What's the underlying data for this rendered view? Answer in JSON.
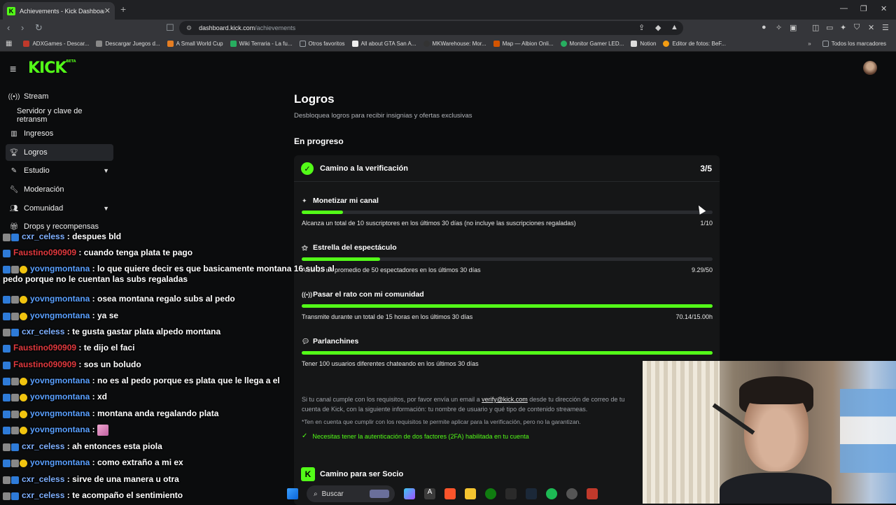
{
  "browser": {
    "tab_title": "Achievements - Kick Dashboard",
    "tab_close": "✕",
    "new_tab": "+",
    "url_host": "dashboard.kick.com",
    "url_path": "/achievements",
    "bookmarks": [
      {
        "label": "ADXGames - Descar...",
        "color": "#c0392b"
      },
      {
        "label": "Descargar Juegos d...",
        "color": "#888888"
      },
      {
        "label": "A Small World Cup",
        "color": "#e67e22"
      },
      {
        "label": "Wiki Terraria - La fu...",
        "color": "#27ae60"
      },
      {
        "label": "Otros favoritos",
        "color": "#9aa0a6"
      },
      {
        "label": "All about GTA San A...",
        "color": "#eeeeee"
      },
      {
        "label": "MKWarehouse: Mor...",
        "color": "#333333"
      },
      {
        "label": "Map — Albion Onli...",
        "color": "#d35400"
      },
      {
        "label": "Monitor Gamer LED...",
        "color": "#27ae60"
      },
      {
        "label": "Notion",
        "color": "#dddddd"
      },
      {
        "label": "Editor de fotos: BeF...",
        "color": "#f39c12"
      }
    ],
    "bookmarks_all": "Todos los marcadores"
  },
  "sidebar": {
    "items": [
      {
        "label": "Stream",
        "icon": "broadcast-icon"
      },
      {
        "label": "Servidor y clave de retransm",
        "icon": ""
      },
      {
        "label": "Ingresos",
        "icon": "chart-icon"
      },
      {
        "label": "Logros",
        "icon": "trophy-icon"
      },
      {
        "label": "Estudio",
        "icon": "pen-icon"
      },
      {
        "label": "Moderación",
        "icon": "wrench-icon"
      },
      {
        "label": "Comunidad",
        "icon": "people-icon"
      },
      {
        "label": "Drops y recompensas",
        "icon": "gift-icon"
      }
    ]
  },
  "main": {
    "title": "Logros",
    "subtitle": "Desbloquea logros para recibir insignias y ofertas exclusivas",
    "section": "En progreso",
    "card": {
      "title": "Camino a la verificación",
      "count": "3/5",
      "achievements": [
        {
          "title": "Monetizar mi canal",
          "desc": "Alcanza un total de 10 suscriptores en los últimos 30 días (no incluye las suscripciones regaladas)",
          "value": "1/10",
          "progress": 0.1
        },
        {
          "title": "Estrella del espectáculo",
          "desc": "Alcanza un promedio de 50 espectadores en los últimos 30 días",
          "value": "9.29/50",
          "progress": 0.19
        },
        {
          "title": "Pasar el rato con mi comunidad",
          "desc": "Transmite durante un total de 15 horas en los últimos 30 días",
          "value": "70.14/15.00h",
          "progress": 1.0
        },
        {
          "title": "Parlanchines",
          "desc": "Tener 100 usuarios diferentes chateando en los últimos 30 días",
          "value": "",
          "progress": 1.0
        }
      ],
      "note_prefix": "Si tu canal cumple con los requisitos, por favor envía un email a ",
      "note_email": "verify@kick.com",
      "note_suffix": " desde tu dirección de correo de tu cuenta de Kick, con la siguiente información: tu nombre de usuario y qué tipo de contenido streameas.",
      "note2": "*Ten en cuenta que cumplir con los requisitos te permite aplicar para la verificación, pero no la garantizan.",
      "note3": "Necesitas tener la autenticación de dos factores (2FA) habilitada en tu cuenta"
    },
    "card2_title": "Camino para ser Socio"
  },
  "chat": [
    {
      "user": "cxr_celess",
      "color": "#7fb0ff",
      "text": ": despues bld"
    },
    {
      "user": "Faustino090909",
      "color": "#e0393e",
      "text": ": cuando tenga plata te pago"
    },
    {
      "user": "yovngmontana",
      "color": "#5aa0ff",
      "text": ": lo que quiere decir es que basicamente montana 16 subs al pedo porque no le cuentan las subs regaladas"
    },
    {
      "user": "yovngmontana",
      "color": "#5aa0ff",
      "text": ": osea montana regalo subs al pedo"
    },
    {
      "user": "yovngmontana",
      "color": "#5aa0ff",
      "text": ": ya se"
    },
    {
      "user": "cxr_celess",
      "color": "#7fb0ff",
      "text": ": te gusta gastar plata alpedo montana"
    },
    {
      "user": "Faustino090909",
      "color": "#e0393e",
      "text": ": te dijo el faci"
    },
    {
      "user": "Faustino090909",
      "color": "#e0393e",
      "text": ": sos un boludo"
    },
    {
      "user": "yovngmontana",
      "color": "#5aa0ff",
      "text": ": no es al pedo porque es plata que le llega a el"
    },
    {
      "user": "yovngmontana",
      "color": "#5aa0ff",
      "text": ": xd"
    },
    {
      "user": "yovngmontana",
      "color": "#5aa0ff",
      "text": ": montana anda regalando plata"
    },
    {
      "user": "yovngmontana",
      "color": "#5aa0ff",
      "text": ":"
    },
    {
      "user": "cxr_celess",
      "color": "#7fb0ff",
      "text": ": ah entonces esta piola"
    },
    {
      "user": "yovngmontana",
      "color": "#5aa0ff",
      "text": ": como extraño a mi ex"
    },
    {
      "user": "cxr_celess",
      "color": "#7fb0ff",
      "text": ": sirve de una manera u otra"
    },
    {
      "user": "cxr_celess",
      "color": "#7fb0ff",
      "text": ": te acompaño el sentimiento"
    }
  ],
  "taskbar": {
    "search": "Buscar"
  }
}
